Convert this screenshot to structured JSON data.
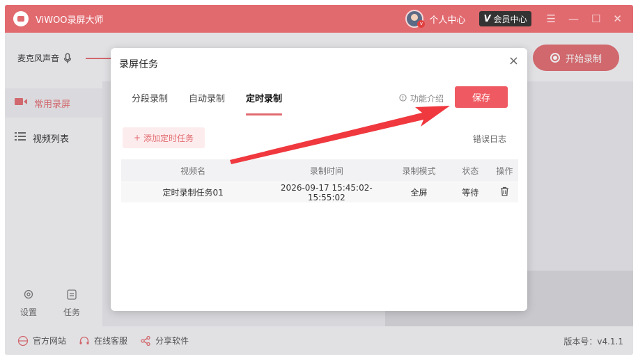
{
  "app": {
    "title": "ViWOO录屏大师"
  },
  "titlebar": {
    "profile_label": "个人中心",
    "vip_label": "会员中心",
    "vip_icon": "V"
  },
  "toolbar": {
    "mic_label": "麦克风声音",
    "start_label": "开始录制"
  },
  "sidebar": {
    "items": [
      {
        "label": "常用录屏",
        "active": true
      },
      {
        "label": "视频列表",
        "active": false
      }
    ],
    "bottom": [
      {
        "label": "设置"
      },
      {
        "label": "任务"
      }
    ]
  },
  "footer": {
    "links": [
      {
        "label": "官方网站"
      },
      {
        "label": "在线客服"
      },
      {
        "label": "分享软件"
      }
    ],
    "version": "版本号：v4.1.1"
  },
  "modal": {
    "title": "录屏任务",
    "close_icon": "×",
    "tabs": [
      {
        "label": "分段录制",
        "active": false
      },
      {
        "label": "自动录制",
        "active": false
      },
      {
        "label": "定时录制",
        "active": true
      }
    ],
    "feature_intro": "功能介绍",
    "save_label": "保存",
    "add_label": "添加定时任务",
    "error_log": "错误日志",
    "table": {
      "headers": [
        "视频名",
        "录制时间",
        "录制模式",
        "状态",
        "操作"
      ],
      "rows": [
        {
          "name": "定时录制任务01",
          "time": "2026-09-17 15:45:02-15:55:02",
          "mode": "全屏",
          "status": "等待"
        }
      ]
    }
  },
  "colors": {
    "accent": "#e16a6f",
    "save": "#ef5a62",
    "arrow": "#f0383f"
  }
}
